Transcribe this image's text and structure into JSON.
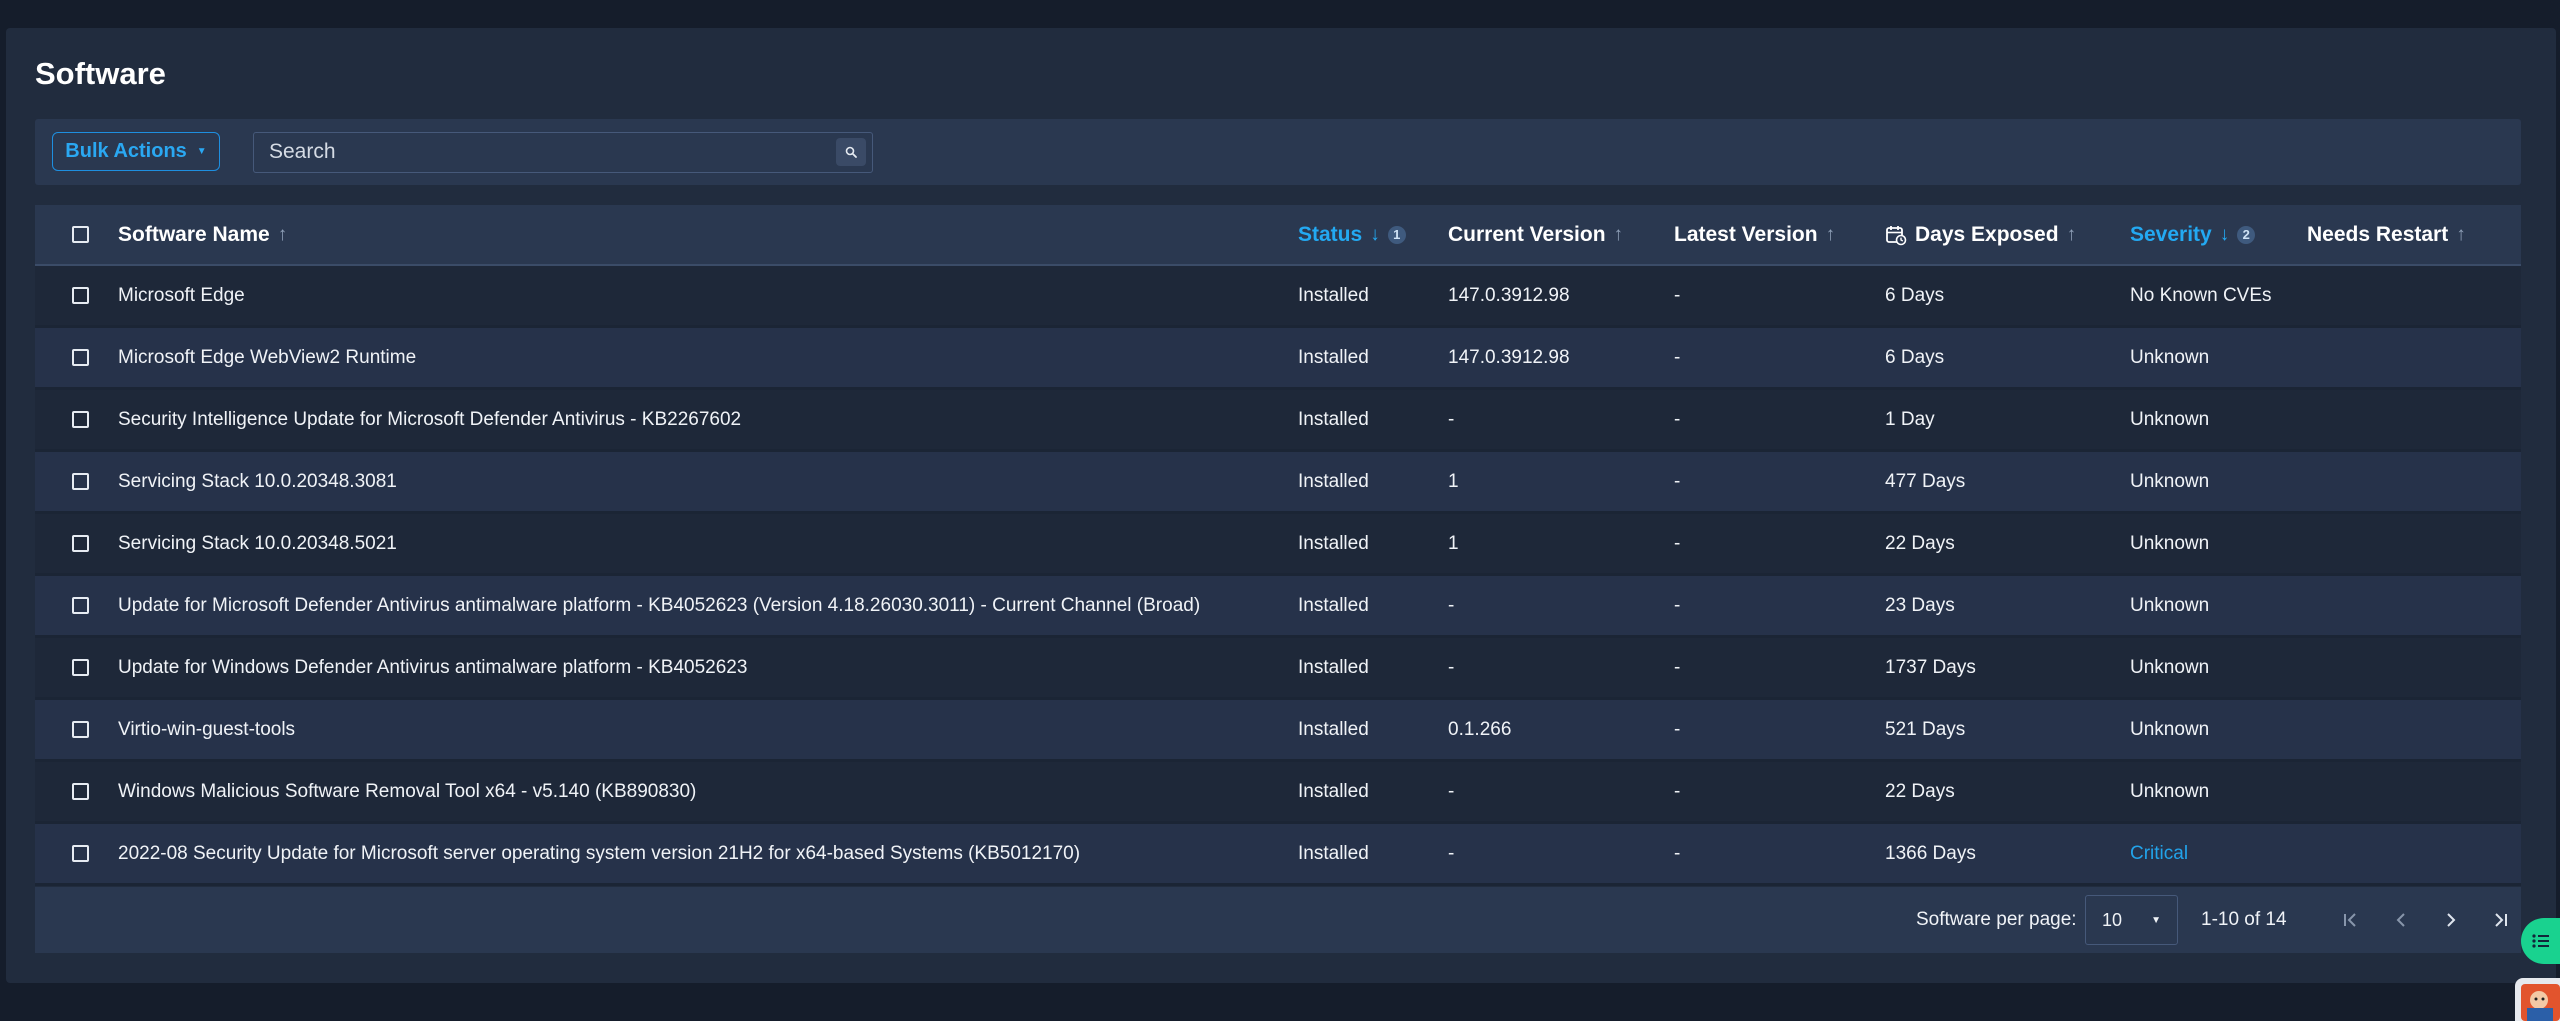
{
  "page": {
    "title": "Software"
  },
  "toolbar": {
    "bulk_actions_label": "Bulk Actions",
    "search_placeholder": "Search",
    "search_value": ""
  },
  "table": {
    "columns": [
      {
        "key": "name",
        "label": "Software Name",
        "sort": "asc",
        "active": false,
        "badge": ""
      },
      {
        "key": "status",
        "label": "Status",
        "sort": "desc",
        "active": true,
        "badge": "1"
      },
      {
        "key": "current_version",
        "label": "Current Version",
        "sort": "asc",
        "active": false,
        "badge": ""
      },
      {
        "key": "latest_version",
        "label": "Latest Version",
        "sort": "asc",
        "active": false,
        "badge": ""
      },
      {
        "key": "days_exposed",
        "label": "Days Exposed",
        "sort": "asc",
        "active": false,
        "badge": "",
        "icon": "calendar-clock-icon"
      },
      {
        "key": "severity",
        "label": "Severity",
        "sort": "desc",
        "active": true,
        "badge": "2"
      },
      {
        "key": "needs_restart",
        "label": "Needs Restart",
        "sort": "asc",
        "active": false,
        "badge": ""
      }
    ],
    "rows": [
      {
        "name": "Microsoft Edge",
        "status": "Installed",
        "current_version": "147.0.3912.98",
        "latest_version": "-",
        "days_exposed": "6 Days",
        "severity": "No Known CVEs",
        "needs_restart": ""
      },
      {
        "name": "Microsoft Edge WebView2 Runtime",
        "status": "Installed",
        "current_version": "147.0.3912.98",
        "latest_version": "-",
        "days_exposed": "6 Days",
        "severity": "Unknown",
        "needs_restart": ""
      },
      {
        "name": "Security Intelligence Update for Microsoft Defender Antivirus - KB2267602",
        "status": "Installed",
        "current_version": "-",
        "latest_version": "-",
        "days_exposed": "1 Day",
        "severity": "Unknown",
        "needs_restart": ""
      },
      {
        "name": "Servicing Stack 10.0.20348.3081",
        "status": "Installed",
        "current_version": "1",
        "latest_version": "-",
        "days_exposed": "477 Days",
        "severity": "Unknown",
        "needs_restart": ""
      },
      {
        "name": "Servicing Stack 10.0.20348.5021",
        "status": "Installed",
        "current_version": "1",
        "latest_version": "-",
        "days_exposed": "22 Days",
        "severity": "Unknown",
        "needs_restart": ""
      },
      {
        "name": "Update for Microsoft Defender Antivirus antimalware platform - KB4052623 (Version 4.18.26030.3011) - Current Channel (Broad)",
        "status": "Installed",
        "current_version": "-",
        "latest_version": "-",
        "days_exposed": "23 Days",
        "severity": "Unknown",
        "needs_restart": ""
      },
      {
        "name": "Update for Windows Defender Antivirus antimalware platform - KB4052623",
        "status": "Installed",
        "current_version": "-",
        "latest_version": "-",
        "days_exposed": "1737 Days",
        "severity": "Unknown",
        "needs_restart": ""
      },
      {
        "name": "Virtio-win-guest-tools",
        "status": "Installed",
        "current_version": "0.1.266",
        "latest_version": "-",
        "days_exposed": "521 Days",
        "severity": "Unknown",
        "needs_restart": ""
      },
      {
        "name": "Windows Malicious Software Removal Tool x64 - v5.140 (KB890830)",
        "status": "Installed",
        "current_version": "-",
        "latest_version": "-",
        "days_exposed": "22 Days",
        "severity": "Unknown",
        "needs_restart": ""
      },
      {
        "name": "2022-08 Security Update for Microsoft server operating system version 21H2 for x64-based Systems (KB5012170)",
        "status": "Installed",
        "current_version": "-",
        "latest_version": "-",
        "days_exposed": "1366 Days",
        "severity": "Critical",
        "needs_restart": ""
      }
    ]
  },
  "pagination": {
    "per_page_label": "Software per page:",
    "per_page_value": "10",
    "range_text": "1-10 of 14"
  },
  "colors": {
    "accent": "#23a9f2",
    "critical": "#22a3ea",
    "fab": "#19d28f"
  }
}
